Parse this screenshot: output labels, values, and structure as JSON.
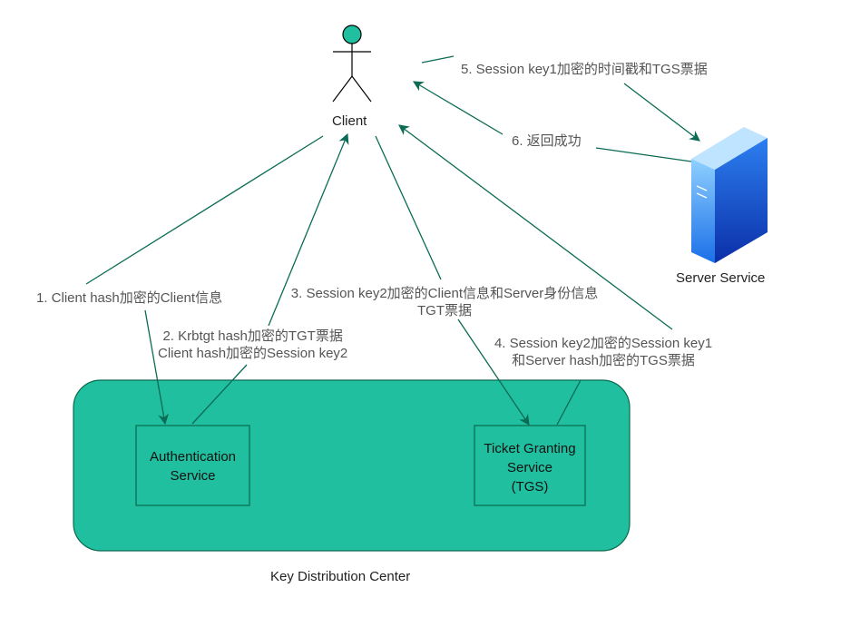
{
  "colors": {
    "kdc_fill": "#1fbf9f",
    "kdc_stroke": "#0b6b4f",
    "arrow": "#0b6b55",
    "actor_head": "#1fbf9f",
    "server_light": "#5fb3ff",
    "server_dark": "#0b4fd1"
  },
  "nodes": {
    "client_label": "Client",
    "server_label": "Server Service",
    "kdc_label": "Key Distribution Center",
    "as_line1": "Authentication",
    "as_line2": "Service",
    "tgs_line1": "Ticket Granting",
    "tgs_line2": "Service",
    "tgs_line3": "(TGS)"
  },
  "edges": {
    "step1": "1. Client hash加密的Client信息",
    "step2_line1": "2. Krbtgt hash加密的TGT票据",
    "step2_line2": "Client hash加密的Session key2",
    "step3_line1": "3. Session key2加密的Client信息和Server身份信息",
    "step3_line2": "TGT票据",
    "step4_line1": "4. Session key2加密的Session key1",
    "step4_line2": "和Server hash加密的TGS票据",
    "step5": "5. Session key1加密的时间戳和TGS票据",
    "step6": "6. 返回成功"
  }
}
